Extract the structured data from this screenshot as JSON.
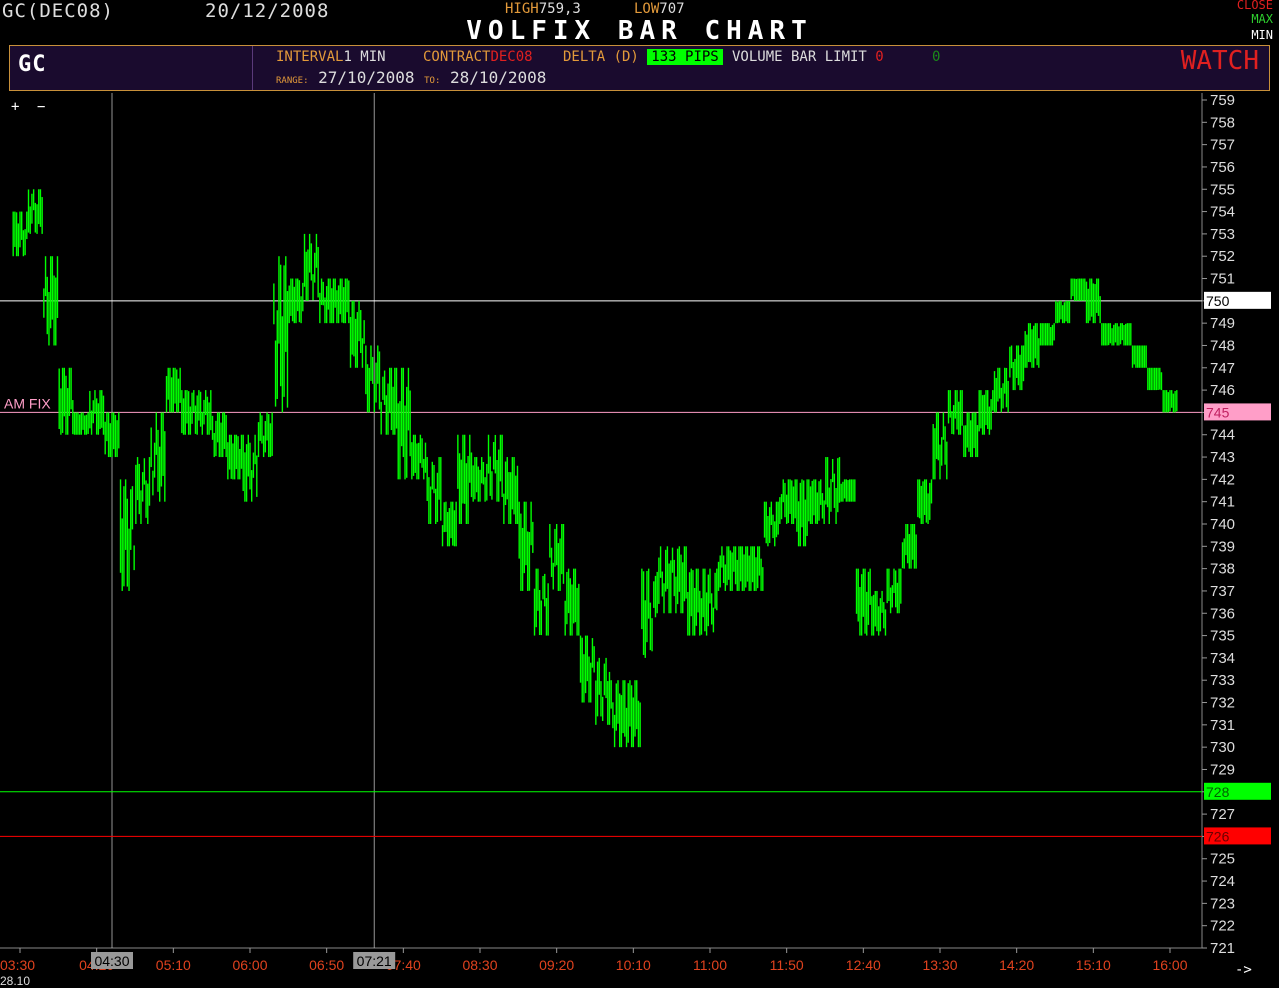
{
  "header": {
    "symbol_date": "GC(DEC08)",
    "date": "20/12/2008",
    "high_label": "HIGH",
    "high_value": "759,3",
    "low_label": "LOW",
    "low_value": "707",
    "title": "VOLFIX BAR CHART",
    "close_label": "CLOSE",
    "max_label": "MAX",
    "min_label": "MIN"
  },
  "infobar": {
    "symbol": "GC",
    "interval_label": "INTERVAL",
    "interval_value": "1 MIN",
    "contract_label": "CONTRACT",
    "contract_value": "DEC08",
    "delta_label": "DELTA (D)",
    "delta_value": "133 PIPS",
    "volume_label": "VOLUME BAR LIMIT",
    "volume_value": "0",
    "volume_extra": "0",
    "range_label": "RANGE:",
    "range_from": "27/10/2008",
    "to_label": "TO:",
    "range_to": "28/10/2008",
    "watch_label": "WATCH"
  },
  "toolbar": {
    "plus": "+",
    "minus": "−"
  },
  "footer": {
    "date": "28.10",
    "arrow": "->"
  },
  "colors": {
    "price": "#00ff00",
    "level_white": "#ffffff",
    "level_pink": "#ff9ec8",
    "level_green": "#00ff00",
    "level_red": "#ff0000",
    "axis_time": "#e0421e"
  },
  "chart_data": {
    "type": "bar",
    "title": "VOLFIX BAR CHART",
    "ylim": [
      721,
      759
    ],
    "y_ticks": [
      721,
      722,
      723,
      724,
      725,
      726,
      727,
      728,
      729,
      730,
      731,
      732,
      733,
      734,
      735,
      736,
      737,
      738,
      739,
      740,
      741,
      742,
      743,
      744,
      745,
      746,
      747,
      748,
      749,
      750,
      751,
      752,
      753,
      754,
      755,
      756,
      757,
      758,
      759
    ],
    "x_ticks": [
      "03:30",
      "04:20",
      "05:10",
      "06:00",
      "06:50",
      "07:40",
      "08:30",
      "09:20",
      "10:10",
      "11:00",
      "11:50",
      "12:40",
      "13:30",
      "14:20",
      "15:10",
      "16:00"
    ],
    "cursor_labels": [
      "04:30",
      "07:21"
    ],
    "levels": [
      {
        "value": 750,
        "label": "750",
        "color": "#ffffff"
      },
      {
        "value": 745,
        "label": "745",
        "color": "#ff9ec8",
        "name": "AM FIX"
      },
      {
        "value": 728,
        "label": "728",
        "color": "#00ff00"
      },
      {
        "value": 726,
        "label": "726",
        "color": "#ff0000"
      }
    ],
    "series": [
      {
        "values": [
          [
            "03:30",
            752,
            754
          ],
          [
            "03:40",
            753,
            755
          ],
          [
            "03:50",
            748,
            752
          ],
          [
            "04:00",
            744,
            747
          ],
          [
            "04:10",
            744,
            745
          ],
          [
            "04:20",
            744,
            746
          ],
          [
            "04:30",
            743,
            745
          ],
          [
            "04:40",
            737,
            742
          ],
          [
            "04:50",
            740,
            743
          ],
          [
            "05:00",
            741,
            745
          ],
          [
            "05:10",
            745,
            747
          ],
          [
            "05:20",
            744,
            746
          ],
          [
            "05:30",
            744,
            746
          ],
          [
            "05:40",
            743,
            745
          ],
          [
            "05:50",
            742,
            744
          ],
          [
            "06:00",
            741,
            744
          ],
          [
            "06:10",
            743,
            745
          ],
          [
            "06:20",
            745,
            752
          ],
          [
            "06:30",
            749,
            751
          ],
          [
            "06:40",
            750,
            753
          ],
          [
            "06:50",
            749,
            751
          ],
          [
            "07:00",
            749,
            751
          ],
          [
            "07:10",
            747,
            750
          ],
          [
            "07:20",
            745,
            748
          ],
          [
            "07:30",
            744,
            747
          ],
          [
            "07:40",
            742,
            747
          ],
          [
            "07:50",
            742,
            744
          ],
          [
            "08:00",
            740,
            743
          ],
          [
            "08:10",
            739,
            741
          ],
          [
            "08:20",
            740,
            744
          ],
          [
            "08:30",
            741,
            743
          ],
          [
            "08:40",
            741,
            744
          ],
          [
            "08:50",
            740,
            743
          ],
          [
            "09:00",
            737,
            741
          ],
          [
            "09:10",
            735,
            738
          ],
          [
            "09:20",
            737,
            740
          ],
          [
            "09:30",
            735,
            738
          ],
          [
            "09:40",
            732,
            735
          ],
          [
            "09:50",
            731,
            734
          ],
          [
            "10:00",
            730,
            733
          ],
          [
            "10:10",
            730,
            733
          ],
          [
            "10:20",
            734,
            738
          ],
          [
            "10:30",
            736,
            739
          ],
          [
            "10:40",
            736,
            739
          ],
          [
            "10:50",
            735,
            738
          ],
          [
            "11:00",
            735,
            738
          ],
          [
            "11:10",
            737,
            739
          ],
          [
            "11:20",
            737,
            739
          ],
          [
            "11:30",
            737,
            739
          ],
          [
            "11:40",
            739,
            741
          ],
          [
            "11:50",
            740,
            742
          ],
          [
            "12:00",
            739,
            742
          ],
          [
            "12:10",
            740,
            742
          ],
          [
            "12:20",
            740,
            743
          ],
          [
            "12:30",
            741,
            742
          ],
          [
            "12:40",
            735,
            738
          ],
          [
            "12:50",
            735,
            737
          ],
          [
            "13:00",
            736,
            738
          ],
          [
            "13:10",
            738,
            740
          ],
          [
            "13:20",
            740,
            742
          ],
          [
            "13:30",
            742,
            745
          ],
          [
            "13:40",
            744,
            746
          ],
          [
            "13:50",
            743,
            745
          ],
          [
            "14:00",
            744,
            746
          ],
          [
            "14:10",
            745,
            747
          ],
          [
            "14:20",
            746,
            748
          ],
          [
            "14:30",
            747,
            749
          ],
          [
            "14:40",
            748,
            749
          ],
          [
            "14:50",
            749,
            750
          ],
          [
            "15:00",
            750,
            751
          ],
          [
            "15:10",
            749,
            751
          ],
          [
            "15:20",
            748,
            749
          ],
          [
            "15:30",
            748,
            749
          ],
          [
            "15:40",
            747,
            748
          ],
          [
            "15:50",
            746,
            747
          ],
          [
            "16:00",
            745,
            746
          ]
        ]
      }
    ]
  }
}
